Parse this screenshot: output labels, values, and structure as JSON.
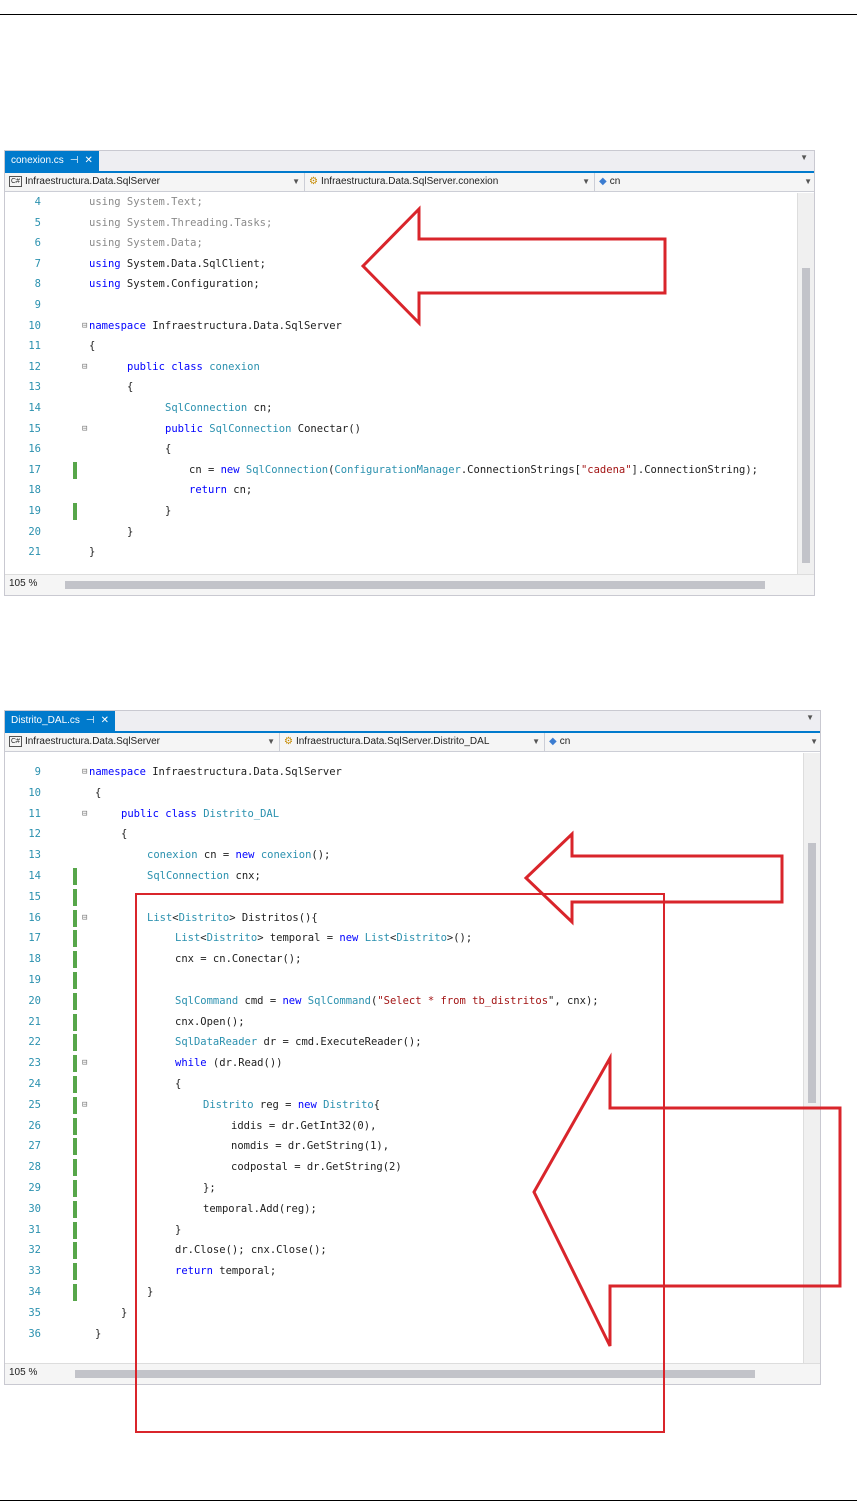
{
  "editor1": {
    "tab": {
      "label": "conexion.cs",
      "pin": "⊣",
      "close": "✕"
    },
    "nav": {
      "project": "Infraestructura.Data.SqlServer",
      "type": "Infraestructura.Data.SqlServer.conexion",
      "member": "cn"
    },
    "zoom": "105 %",
    "lines": [
      {
        "n": "4",
        "t": "using System.Text;"
      },
      {
        "n": "5",
        "t": "using System.Threading.Tasks;"
      },
      {
        "n": "6",
        "t": "using System.Data;"
      },
      {
        "n": "7",
        "t": "using System.Data.SqlClient;"
      },
      {
        "n": "8",
        "t": "using System.Configuration;"
      },
      {
        "n": "9",
        "t": ""
      },
      {
        "n": "10",
        "t": "namespace Infraestructura.Data.SqlServer"
      },
      {
        "n": "11",
        "t": "{"
      },
      {
        "n": "12",
        "t": "public class conexion"
      },
      {
        "n": "13",
        "t": "{"
      },
      {
        "n": "14",
        "t": "SqlConnection cn;"
      },
      {
        "n": "15",
        "t": "public SqlConnection Conectar()"
      },
      {
        "n": "16",
        "t": "{"
      },
      {
        "n": "17",
        "t": "cn = new SqlConnection(ConfigurationManager.ConnectionStrings[\"cadena\"].ConnectionString);"
      },
      {
        "n": "18",
        "t": "return cn;"
      },
      {
        "n": "19",
        "t": "}"
      },
      {
        "n": "20",
        "t": "}"
      },
      {
        "n": "21",
        "t": "}"
      }
    ]
  },
  "editor2": {
    "tab": {
      "label": "Distrito_DAL.cs",
      "pin": "⊣",
      "close": "✕"
    },
    "nav": {
      "project": "Infraestructura.Data.SqlServer",
      "type": "Infraestructura.Data.SqlServer.Distrito_DAL",
      "member": "cn"
    },
    "zoom": "105 %",
    "lines": [
      {
        "n": "9",
        "t": "namespace Infraestructura.Data.SqlServer"
      },
      {
        "n": "10",
        "t": "{"
      },
      {
        "n": "11",
        "t": "public class Distrito_DAL"
      },
      {
        "n": "12",
        "t": "{"
      },
      {
        "n": "13",
        "t": "conexion cn = new conexion();"
      },
      {
        "n": "14",
        "t": "SqlConnection cnx;"
      },
      {
        "n": "15",
        "t": ""
      },
      {
        "n": "16",
        "t": "List<Distrito> Distritos(){"
      },
      {
        "n": "17",
        "t": "List<Distrito> temporal = new List<Distrito>();"
      },
      {
        "n": "18",
        "t": "cnx = cn.Conectar();"
      },
      {
        "n": "19",
        "t": ""
      },
      {
        "n": "20",
        "t": "SqlCommand cmd = new SqlCommand(\"Select * from tb_distritos\", cnx);"
      },
      {
        "n": "21",
        "t": "cnx.Open();"
      },
      {
        "n": "22",
        "t": "SqlDataReader dr = cmd.ExecuteReader();"
      },
      {
        "n": "23",
        "t": "while (dr.Read())"
      },
      {
        "n": "24",
        "t": "{"
      },
      {
        "n": "25",
        "t": "Distrito reg = new Distrito{"
      },
      {
        "n": "26",
        "t": "iddis = dr.GetInt32(0),"
      },
      {
        "n": "27",
        "t": "nomdis = dr.GetString(1),"
      },
      {
        "n": "28",
        "t": "codpostal = dr.GetString(2)"
      },
      {
        "n": "29",
        "t": "};"
      },
      {
        "n": "30",
        "t": "temporal.Add(reg);"
      },
      {
        "n": "31",
        "t": "}"
      },
      {
        "n": "32",
        "t": "dr.Close(); cnx.Close();"
      },
      {
        "n": "33",
        "t": "return temporal;"
      },
      {
        "n": "34",
        "t": "}"
      },
      {
        "n": "35",
        "t": "}"
      },
      {
        "n": "36",
        "t": "}"
      }
    ]
  },
  "annotation_color": "#d9252b",
  "change_marker_color": "#57a64a",
  "accent": "#007acc"
}
